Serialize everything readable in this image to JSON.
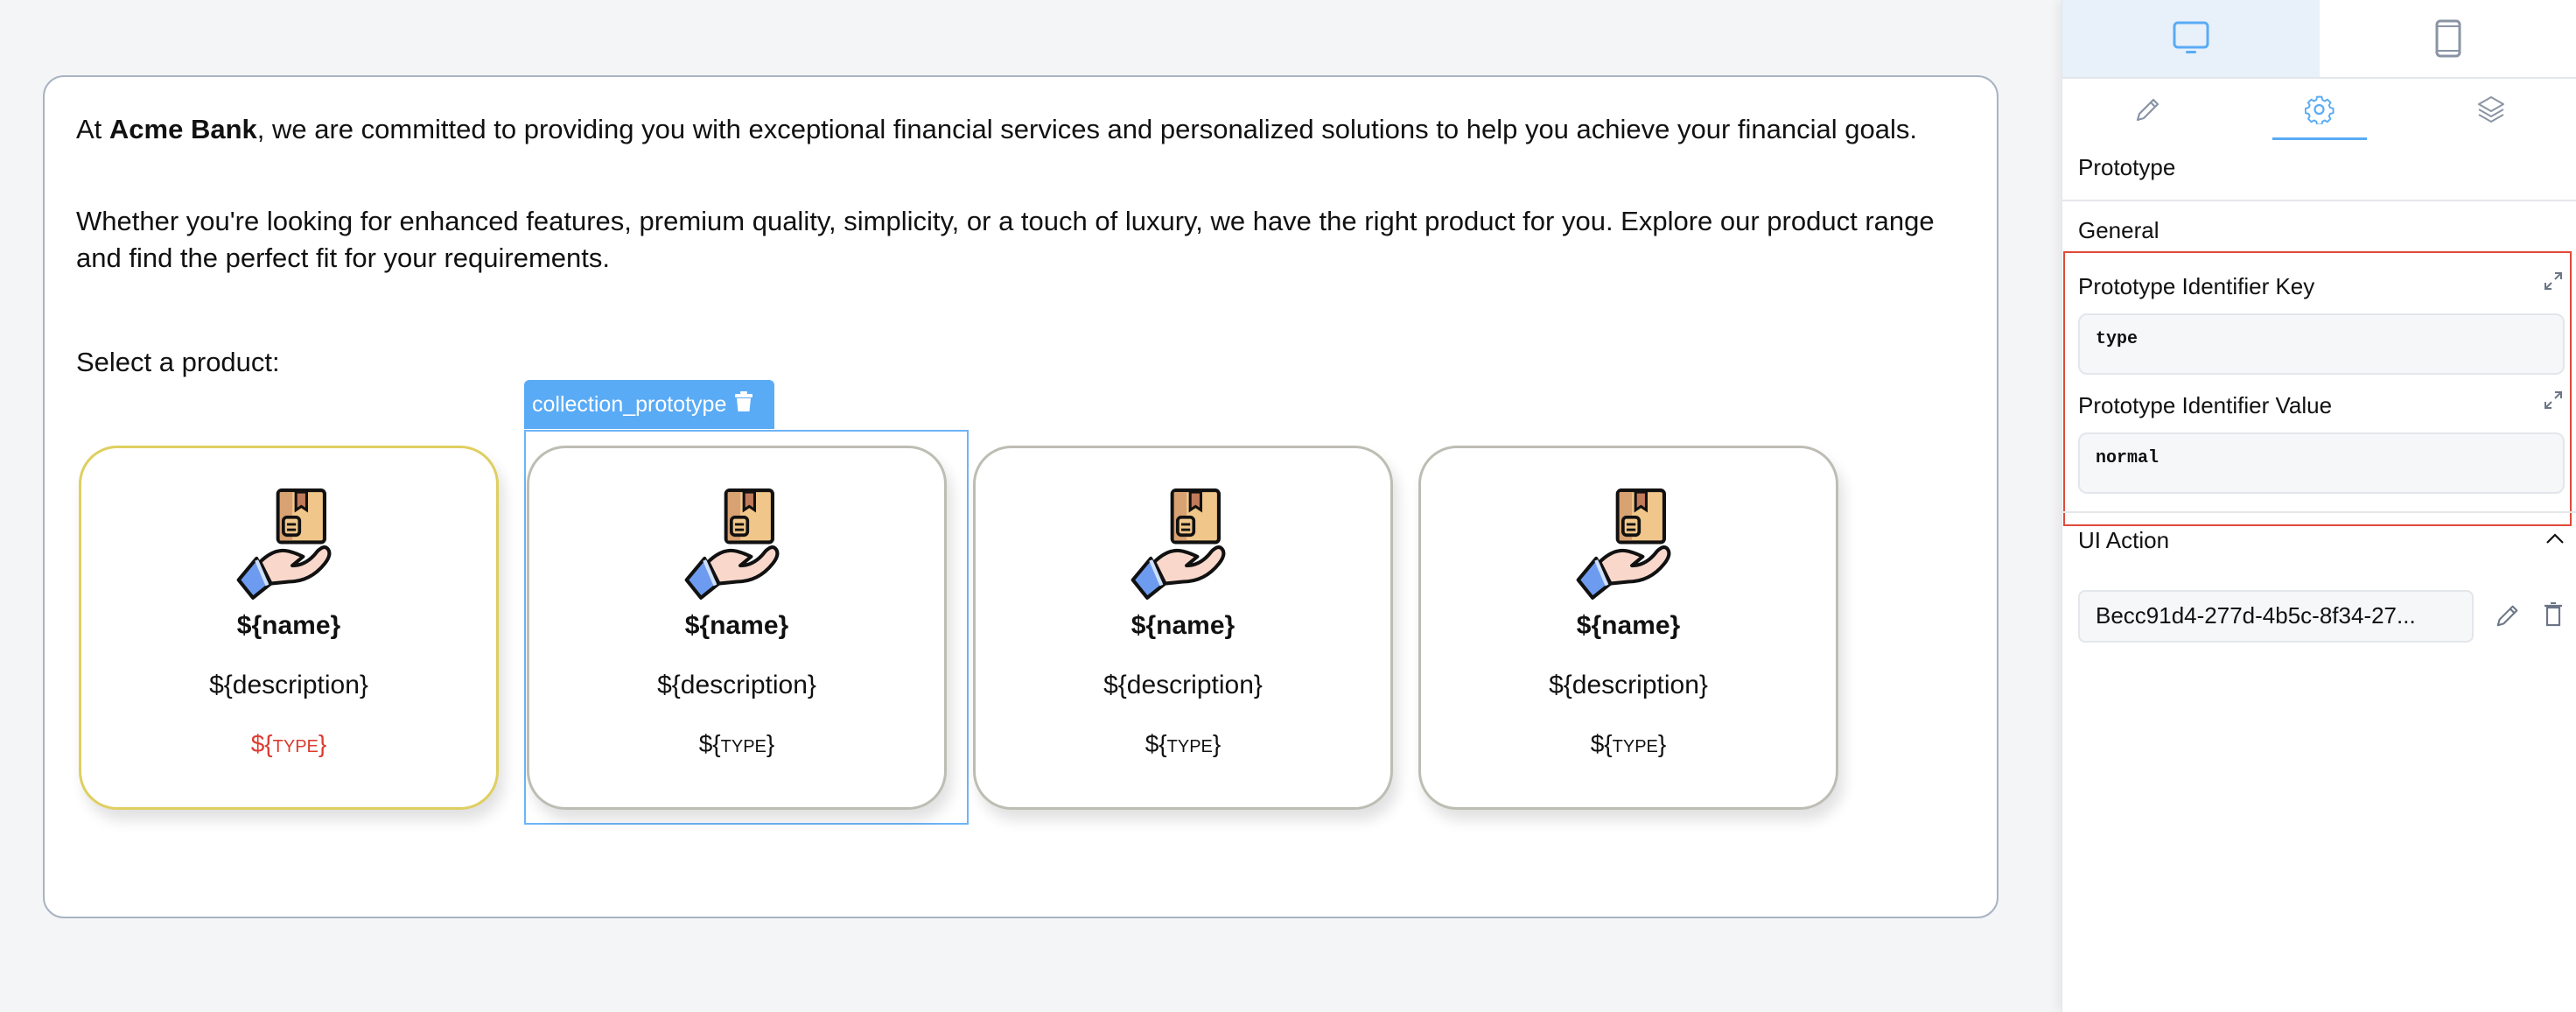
{
  "canvas": {
    "para1": {
      "prefix": "At ",
      "bold": "Acme Bank",
      "rest": ", we are committed to providing you with exceptional financial services and personalized solutions to help you achieve your financial goals."
    },
    "para2": "Whether you're looking for enhanced features, premium quality, simplicity, or a touch of luxury, we have the right product for you. Explore our product range and find the perfect fit for your requirements.",
    "select_label": "Select a product:",
    "selection_tag": {
      "label": "collection_prototype",
      "icon": "trash-icon"
    },
    "cards": [
      {
        "name": "${name}",
        "description": "${description}",
        "type": "${type}",
        "icon": "hand-with-package-icon",
        "highlighted": true
      },
      {
        "name": "${name}",
        "description": "${description}",
        "type": "${type}",
        "icon": "hand-with-package-icon",
        "highlighted": false
      },
      {
        "name": "${name}",
        "description": "${description}",
        "type": "${type}",
        "icon": "hand-with-package-icon",
        "highlighted": false
      },
      {
        "name": "${name}",
        "description": "${description}",
        "type": "${type}",
        "icon": "hand-with-package-icon",
        "highlighted": false
      }
    ]
  },
  "panel": {
    "device_tabs": [
      {
        "name": "desktop",
        "icon": "monitor-icon",
        "active": true
      },
      {
        "name": "mobile",
        "icon": "phone-icon",
        "active": false
      }
    ],
    "tool_tabs": [
      {
        "name": "edit",
        "icon": "pencil-icon",
        "active": false
      },
      {
        "name": "settings",
        "icon": "gear-icon",
        "active": true
      },
      {
        "name": "layers",
        "icon": "layers-icon",
        "active": false
      }
    ],
    "title": "Prototype",
    "general_title": "General",
    "identifier_key": {
      "label": "Prototype Identifier Key",
      "value": "type"
    },
    "identifier_value": {
      "label": "Prototype Identifier Value",
      "value": "normal"
    },
    "ui_action": {
      "title": "UI Action",
      "value": "Becc91d4-277d-4b5c-8f34-27..."
    },
    "colors": {
      "accent": "#5aabf5",
      "highlight_border": "#dfcf60",
      "type_red": "#dc3b30",
      "focus_box": "#e04a3a"
    }
  }
}
